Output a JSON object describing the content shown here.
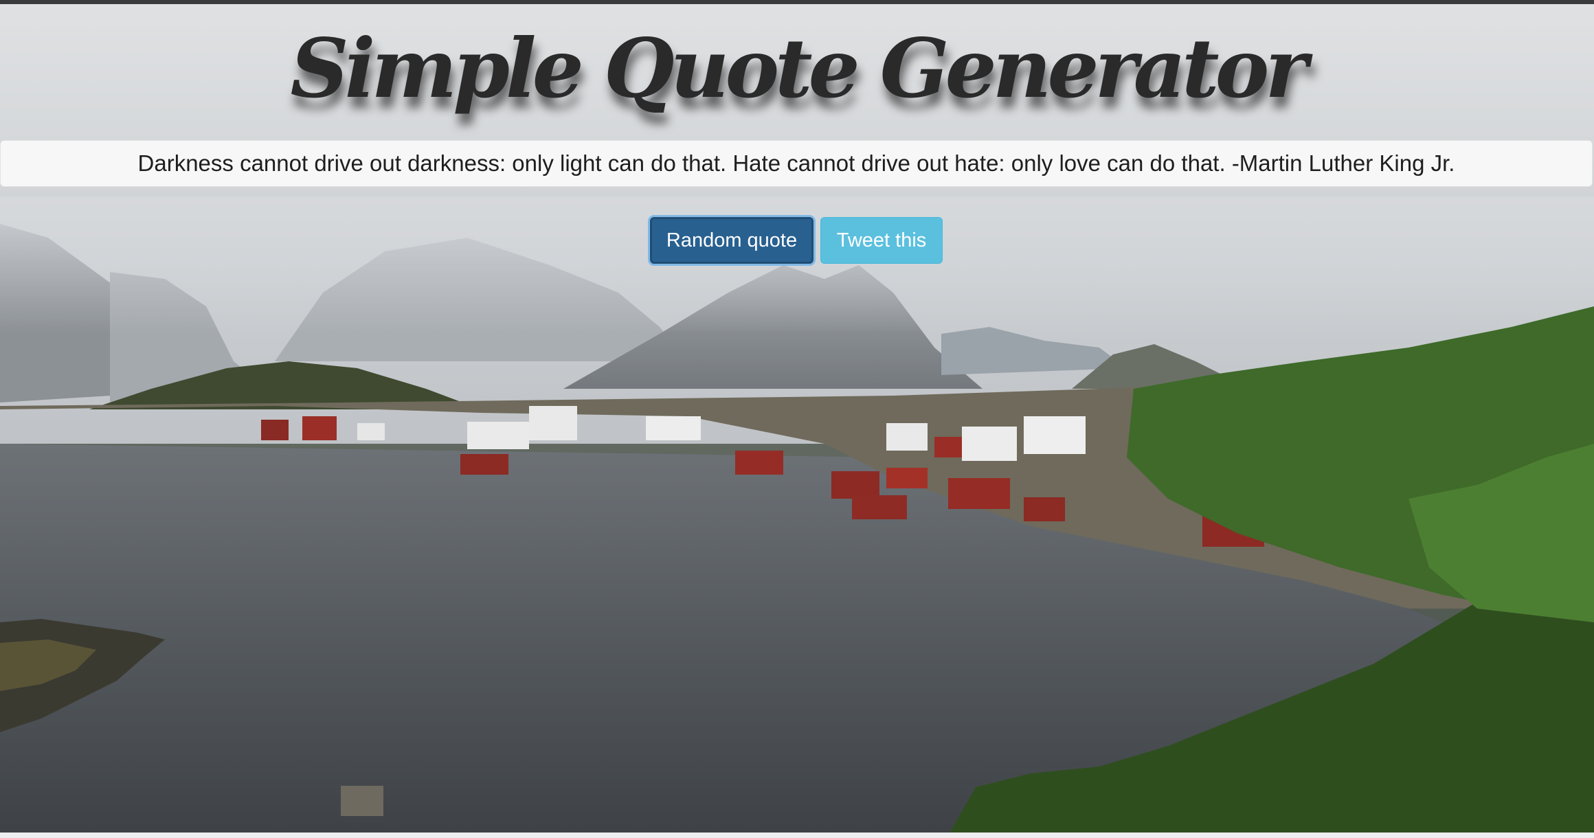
{
  "app": {
    "title": "Simple Quote Generator"
  },
  "quote": {
    "text": "Darkness cannot drive out darkness: only light can do that. Hate cannot drive out hate: only love can do that. -Martin Luther King Jr."
  },
  "buttons": {
    "random_label": "Random quote",
    "tweet_label": "Tweet this"
  },
  "colors": {
    "random_button": "#286090",
    "tweet_button": "#5bc0de",
    "title_text": "#2a2a2a",
    "banner_background": "#f8f8f8"
  },
  "background": {
    "subject": "fjord-village-landscape"
  }
}
